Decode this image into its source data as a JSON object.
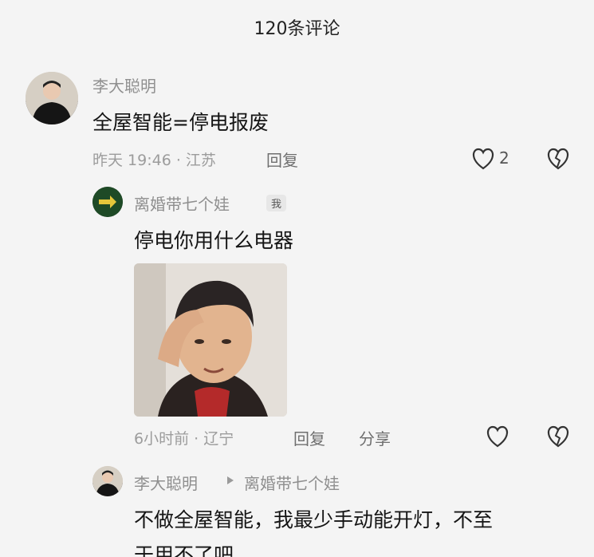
{
  "header": {
    "title": "120条评论"
  },
  "comments": [
    {
      "user": "李大聪明",
      "text": "全屋智能=停电报废",
      "time": "昨天 19:46 · 江苏",
      "reply": "回复",
      "likes": "2"
    },
    {
      "user": "离婚带七个娃",
      "badge": "我",
      "text": "停电你用什么电器",
      "time": "6小时前 · 辽宁",
      "reply": "回复",
      "share": "分享"
    },
    {
      "user": "李大聪明",
      "reply_to": "离婚带七个娃",
      "text": "不做全屋智能，我最少手动能开灯，不至",
      "text_cont": "于用不了吧"
    }
  ],
  "icons": {
    "like": "heart-outline-icon",
    "dislike": "broken-heart-icon",
    "reply_arrow": "triangle-right-icon"
  }
}
